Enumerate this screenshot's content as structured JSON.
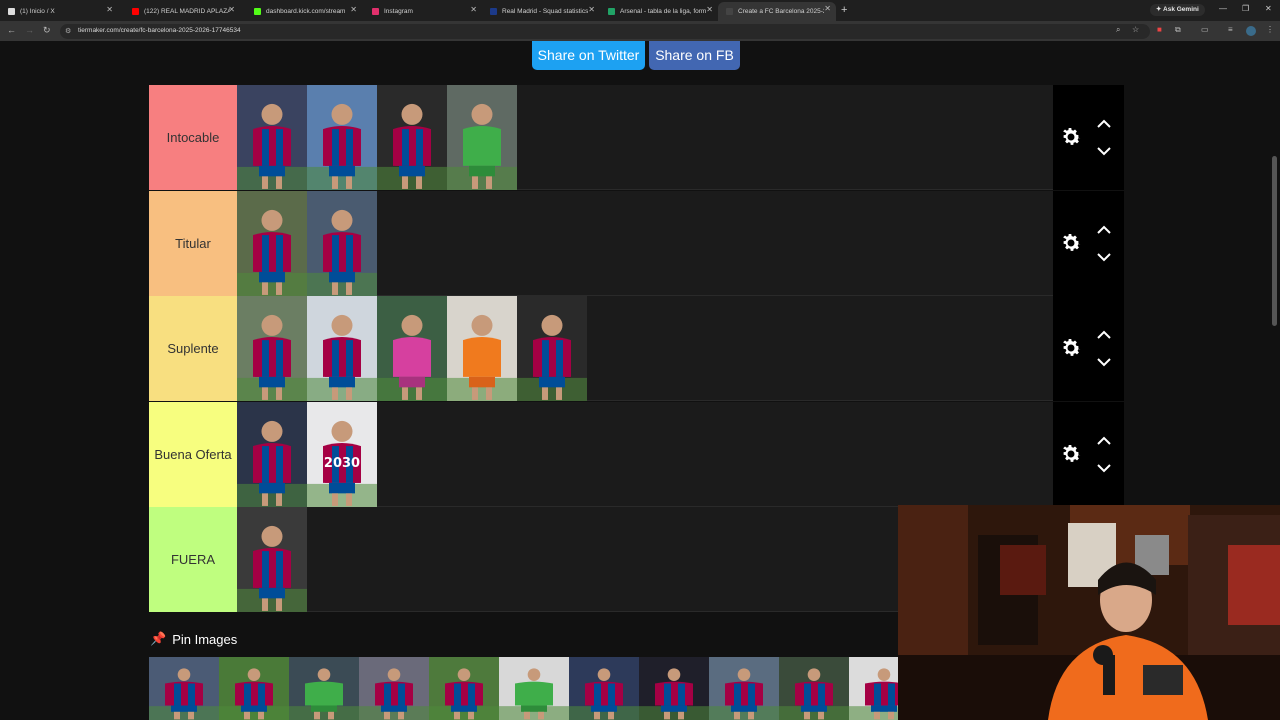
{
  "browser": {
    "tabs": [
      {
        "title": "(1) Inicio / X",
        "fav": "#dddddd"
      },
      {
        "title": "(122) REAL MADRID APLAZA T...",
        "fav": "#ff0000"
      },
      {
        "title": "dashboard.kick.com/stream",
        "fav": "#53fc18"
      },
      {
        "title": "Instagram",
        "fav": "#e1306c"
      },
      {
        "title": "Real Madrid - Squad statistics |",
        "fav": "#1c3a8a"
      },
      {
        "title": "Arsenal - tabla de la liga, forma",
        "fav": "#21a366"
      },
      {
        "title": "Create a FC Barcelona 2025-20",
        "fav": "#444444"
      }
    ],
    "new_tab": "+",
    "gemini_label": "Ask Gemini",
    "url": "tiermaker.com/create/fc-barcelona-2025-2026-17746534"
  },
  "share": {
    "twitter": "Share on Twitter",
    "facebook": "Share on FB"
  },
  "tiers": [
    {
      "label": "Intocable",
      "color": "#f77f80",
      "players": [
        {
          "name": "player-1",
          "kit": "barca",
          "bg": "#3a4360"
        },
        {
          "name": "player-2",
          "kit": "barca",
          "bg": "#5a7fae"
        },
        {
          "name": "player-3",
          "kit": "barca",
          "bg": "#2a2a2a"
        },
        {
          "name": "player-4",
          "kit": "keeper-green",
          "bg": "#5f6a63"
        }
      ]
    },
    {
      "label": "Titular",
      "color": "#f8bf80",
      "players": [
        {
          "name": "player-5",
          "kit": "barca",
          "bg": "#5b6b4a"
        },
        {
          "name": "player-6",
          "kit": "barca",
          "bg": "#4a5b70"
        }
      ]
    },
    {
      "label": "Suplente",
      "color": "#f8df80",
      "players": [
        {
          "name": "player-7",
          "kit": "barca",
          "bg": "#6b7e63"
        },
        {
          "name": "player-8",
          "kit": "barca",
          "bg": "#cfd6dd"
        },
        {
          "name": "player-9",
          "kit": "pink",
          "bg": "#3c5f44"
        },
        {
          "name": "player-10",
          "kit": "orange",
          "bg": "#d8d4cc"
        },
        {
          "name": "player-11",
          "kit": "barca",
          "bg": "#2a2a2a"
        }
      ]
    },
    {
      "label": "Buena Oferta",
      "color": "#f7fe7f",
      "players": [
        {
          "name": "player-12",
          "kit": "barca",
          "bg": "#2b3449"
        },
        {
          "name": "player-13",
          "kit": "shirt-2030",
          "bg": "#e8e8ea"
        }
      ]
    },
    {
      "label": "FUERA",
      "color": "#bffe7f",
      "players": [
        {
          "name": "player-14",
          "kit": "barca",
          "bg": "#3a3a3a"
        }
      ]
    }
  ],
  "pin_images": {
    "label": "Pin Images",
    "players": [
      {
        "kit": "barca",
        "bg": "#4b5b75"
      },
      {
        "kit": "barca",
        "bg": "#4a7a38"
      },
      {
        "kit": "keeper-green",
        "bg": "#3b4b55"
      },
      {
        "kit": "barca",
        "bg": "#6a6a7a"
      },
      {
        "kit": "barca",
        "bg": "#4e7a3c"
      },
      {
        "kit": "keeper-green",
        "bg": "#d8d8d8"
      },
      {
        "kit": "barca",
        "bg": "#2d3a5a"
      },
      {
        "kit": "barca",
        "bg": "#1f1f2a"
      },
      {
        "kit": "barca",
        "bg": "#5a6c80"
      },
      {
        "kit": "barca",
        "bg": "#3a4b3a"
      },
      {
        "kit": "barca",
        "bg": "#dcdcdc"
      }
    ]
  },
  "webcam": {
    "shirt_color": "#f06b1c",
    "bg": "#3a1d10"
  }
}
